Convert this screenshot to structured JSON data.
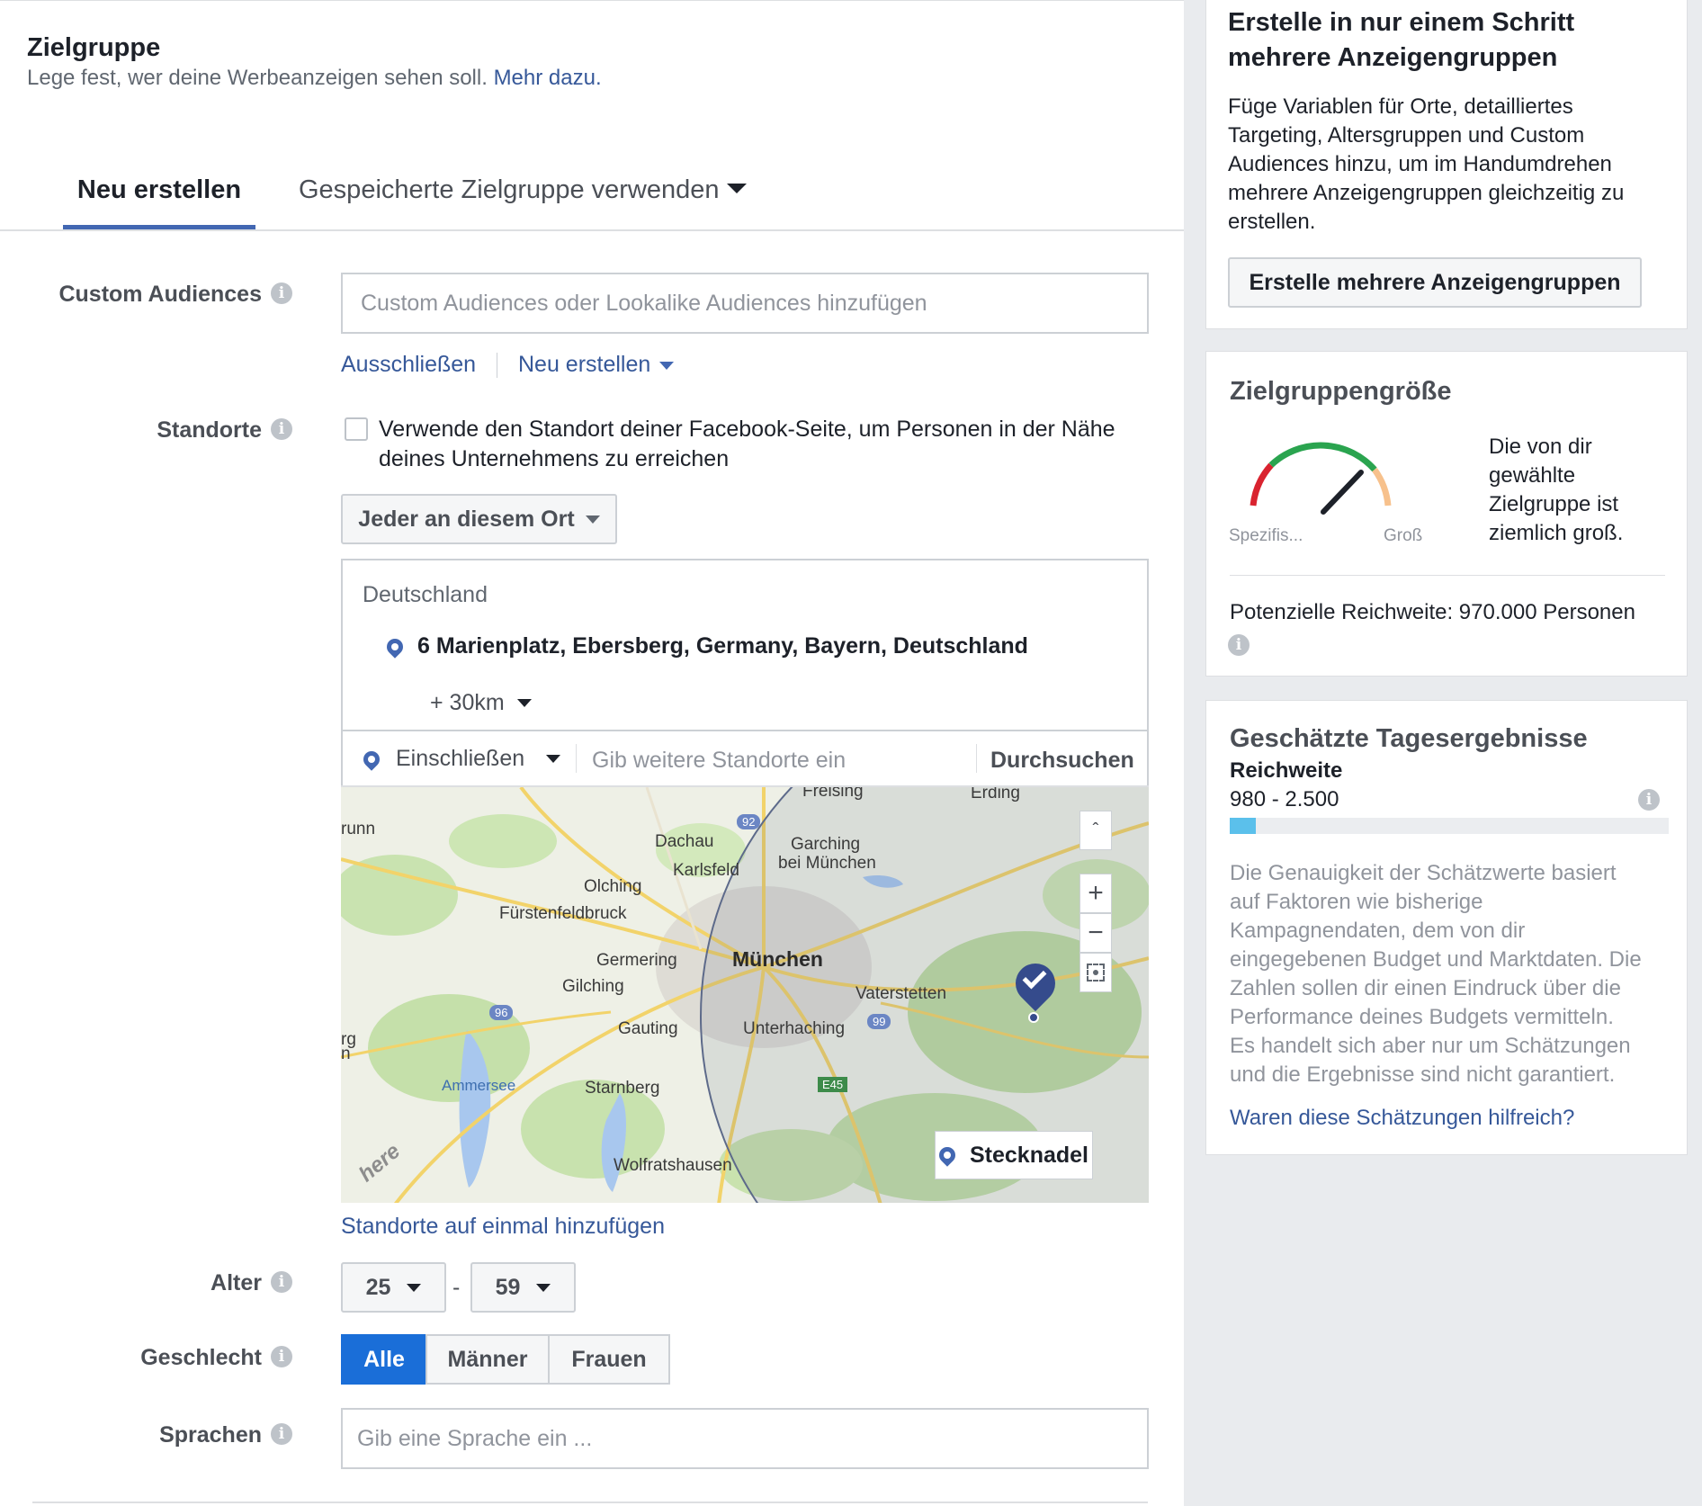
{
  "audience": {
    "title": "Zielgruppe",
    "subtitle": "Lege fest, wer deine Werbeanzeigen sehen soll.",
    "more_link": "Mehr dazu."
  },
  "tabs": {
    "create_new": "Neu erstellen",
    "saved": "Gespeicherte Zielgruppe verwenden"
  },
  "custom_audiences": {
    "label": "Custom Audiences",
    "placeholder": "Custom Audiences oder Lookalike Audiences hinzufügen",
    "exclude_link": "Ausschließen",
    "create_link": "Neu erstellen"
  },
  "locations": {
    "label": "Standorte",
    "checkbox_text_line1": "Verwende den Standort deiner Facebook-Seite, um Personen in der Nähe",
    "checkbox_text_line2": "deines Unternehmens zu erreichen",
    "who_dropdown": "Jeder an diesem Ort",
    "country": "Deutschland",
    "address": "6 Marienplatz, Ebersberg, Germany, Bayern, Deutschland",
    "radius": "+ 30km",
    "include_dropdown": "Einschließen",
    "search_placeholder": "Gib weitere Standorte ein",
    "browse_button": "Durchsuchen",
    "add_bulk_link": "Standorte auf einmal hinzufügen",
    "pin_button": "Stecknadel"
  },
  "map": {
    "places": [
      "Freising",
      "Erding",
      "Dachau",
      "Garching",
      "bei München",
      "Karlsfeld",
      "Olching",
      "Fürstenfeldbruck",
      "Germering",
      "München",
      "Gilching",
      "Vaterstetten",
      "Gauting",
      "Unterhaching",
      "Ammersee",
      "Starnberg",
      "Wolfratshausen",
      "runn",
      "rg",
      "n"
    ],
    "roads": [
      "92",
      "96",
      "99",
      "E45"
    ],
    "logo": "here",
    "collapse": "ˆ",
    "zoom_in": "+",
    "zoom_out": "−"
  },
  "age": {
    "label": "Alter",
    "min": "25",
    "separator": "-",
    "max": "59"
  },
  "gender": {
    "label": "Geschlecht",
    "all": "Alle",
    "men": "Männer",
    "women": "Frauen"
  },
  "languages": {
    "label": "Sprachen",
    "placeholder": "Gib eine Sprache ein ..."
  },
  "side_multi": {
    "title_line1": "Erstelle in nur einem Schritt",
    "title_line2": "mehrere Anzeigengruppen",
    "text_line1": "Füge Variablen für Orte, detailliertes",
    "text_line2": "Targeting, Altersgruppen und Custom",
    "text_line3": "Audiences hinzu, um im Handumdrehen",
    "text_line4": "mehrere Anzeigengruppen gleichzeitig zu",
    "text_line5": "erstellen.",
    "button": "Erstelle mehrere Anzeigengruppen"
  },
  "side_size": {
    "title": "Zielgruppengröße",
    "gauge_left": "Spezifis...",
    "gauge_right": "Groß",
    "desc_line1": "Die von dir",
    "desc_line2": "gewählte",
    "desc_line3": "Zielgruppe ist",
    "desc_line4": "ziemlich groß.",
    "reach": "Potenzielle Reichweite: 970.000 Personen"
  },
  "side_daily": {
    "title": "Geschätzte Tagesergebnisse",
    "reach_label": "Reichweite",
    "reach_value": "980 - 2.500",
    "reach_fill": 0.06,
    "disclaimer_line1": "Die Genauigkeit der Schätzwerte basiert",
    "disclaimer_line2": "auf Faktoren wie bisherige",
    "disclaimer_line3": "Kampagnendaten, dem von dir",
    "disclaimer_line4": "eingegebenen Budget und Marktdaten. Die",
    "disclaimer_line5": "Zahlen sollen dir einen Eindruck über die",
    "disclaimer_line6": "Performance deines Budgets vermitteln.",
    "disclaimer_line7": "Es handelt sich aber nur um Schätzungen",
    "disclaimer_line8": "und die Ergebnisse sind nicht garantiert.",
    "feedback_link": "Waren diese Schätzungen hilfreich?"
  },
  "colors": {
    "accent": "#4267b2",
    "link": "#365899",
    "active_segment": "#1a6ed8",
    "reach_bar": "#5bc0eb"
  }
}
